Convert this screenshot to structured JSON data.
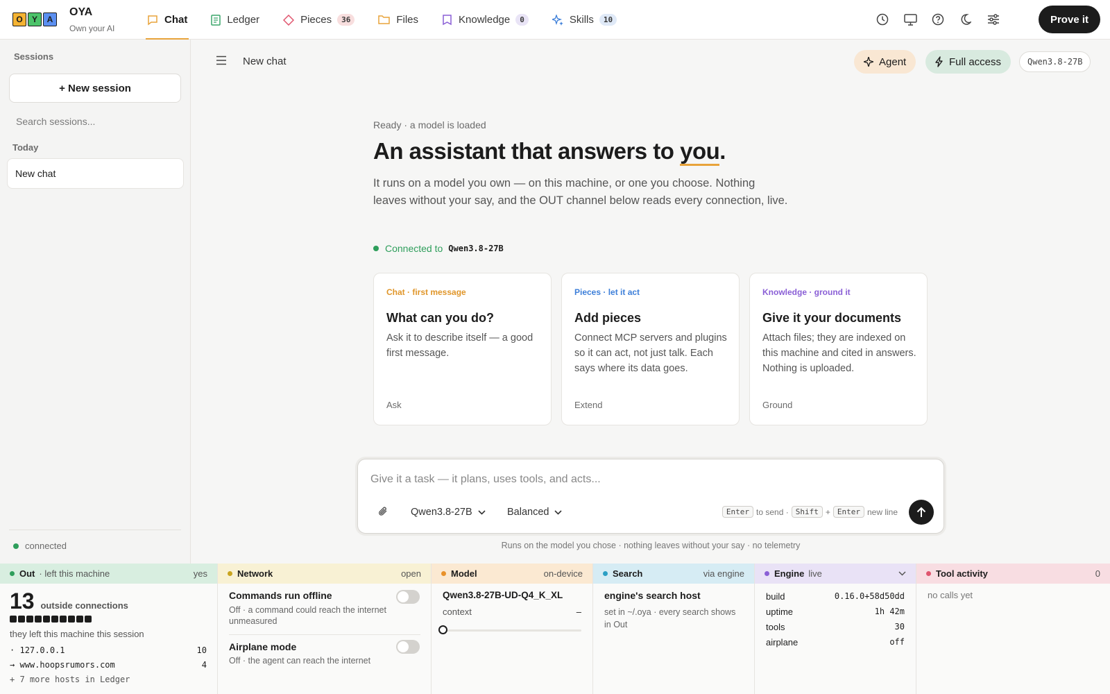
{
  "app": {
    "logo_letters": [
      "O",
      "Y",
      "A"
    ],
    "logo_colors": [
      "#f4b333",
      "#4cc36a",
      "#5b8ff0"
    ],
    "name": "OYA",
    "tagline": "Own your AI"
  },
  "nav": {
    "tabs": [
      {
        "label": "Chat",
        "icon": "chat-bubble-icon",
        "active": true
      },
      {
        "label": "Ledger",
        "icon": "ledger-icon"
      },
      {
        "label": "Pieces",
        "icon": "pieces-icon",
        "badge": "36"
      },
      {
        "label": "Files",
        "icon": "folder-icon"
      },
      {
        "label": "Knowledge",
        "icon": "bookmark-icon",
        "badge": "0"
      },
      {
        "label": "Skills",
        "icon": "sparkle-icon",
        "badge": "10"
      }
    ],
    "icons": [
      "history-icon",
      "monitor-icon",
      "help-icon",
      "moon-icon",
      "sliders-icon"
    ],
    "prove_label": "Prove it"
  },
  "sidebar": {
    "title": "Sessions",
    "new_session": "+ New session",
    "search_placeholder": "Search sessions...",
    "group": "Today",
    "items": [
      "New chat"
    ],
    "status": "connected"
  },
  "header": {
    "title": "New chat",
    "agent_label": "Agent",
    "access_label": "Full access",
    "model_chip": "Qwen3.8-27B"
  },
  "hero": {
    "status": "Ready · a model is loaded",
    "headline_pre": "An assistant that answers to ",
    "headline_em": "you",
    "headline_post": ".",
    "description": "It runs on a model you own — on this machine, or one you choose. Nothing leaves without your say, and the OUT channel below reads every connection, live.",
    "connected_label": "Connected to",
    "connected_model": "Qwen3.8-27B"
  },
  "cards": [
    {
      "kicker": "Chat · first message",
      "color": "#e0962a",
      "title": "What can you do?",
      "desc": "Ask it to describe itself — a good first message.",
      "footer": "Ask"
    },
    {
      "kicker": "Pieces · let it act",
      "color": "#3d7fd9",
      "title": "Add pieces",
      "desc": "Connect MCP servers and plugins so it can act, not just talk. Each says where its data goes.",
      "footer": "Extend"
    },
    {
      "kicker": "Knowledge · ground it",
      "color": "#8a5fd6",
      "title": "Give it your documents",
      "desc": "Attach files; they are indexed on this machine and cited in answers. Nothing is uploaded.",
      "footer": "Ground"
    }
  ],
  "composer": {
    "placeholder": "Give it a task — it plans, uses tools, and acts...",
    "model": "Qwen3.8-27B",
    "mode": "Balanced",
    "key_enter": "Enter",
    "to_send": "to send ·",
    "key_shift": "Shift",
    "plus": "+",
    "new_line": "new line",
    "footer": "Runs on the model you chose · nothing leaves without your say · no telemetry"
  },
  "panels": {
    "out": {
      "title": "Out",
      "sub": "· left this machine",
      "right": "yes",
      "color": "#d8eee0",
      "dot": "#2e9e5b",
      "count": "13",
      "count_label": "outside connections",
      "blocks": 10,
      "note": "they left this machine this session",
      "hosts": [
        {
          "prefix": "·",
          "host": "127.0.0.1",
          "n": "10"
        },
        {
          "prefix": "→",
          "host": "www.hoopsrumors.com",
          "n": "4"
        }
      ],
      "more": "+ 7 more hosts in Ledger"
    },
    "network": {
      "title": "Network",
      "right": "open",
      "color": "#f8f1d4",
      "dot": "#c9a41e",
      "items": [
        {
          "title": "Commands run offline",
          "desc": "Off · a command could reach the internet unmeasured",
          "on": false
        },
        {
          "title": "Airplane mode",
          "desc": "Off · the agent can reach the internet",
          "on": false
        }
      ]
    },
    "model": {
      "title": "Model",
      "right": "on-device",
      "color": "#fbe9d2",
      "dot": "#e8912a",
      "name": "Qwen3.8-27B-UD-Q4_K_XL",
      "context_label": "context",
      "context_value": "–",
      "context_fill": 0
    },
    "search": {
      "title": "Search",
      "right": "via engine",
      "color": "#d6ecf4",
      "dot": "#2a9fc4",
      "host": "engine's search host",
      "desc": "set in ~/.oya · every search shows in Out"
    },
    "engine": {
      "title": "Engine",
      "sub": "live",
      "color": "#e9e2f6",
      "dot": "#8a5fd6",
      "rows": [
        {
          "k": "build",
          "v": "0.16.0+58d50dd"
        },
        {
          "k": "uptime",
          "v": "1h 42m"
        },
        {
          "k": "tools",
          "v": "30"
        },
        {
          "k": "airplane",
          "v": "off"
        }
      ]
    },
    "tools": {
      "title": "Tool activity",
      "right": "0",
      "color": "#f8dde2",
      "dot": "#e0556e",
      "empty": "no calls yet"
    }
  }
}
